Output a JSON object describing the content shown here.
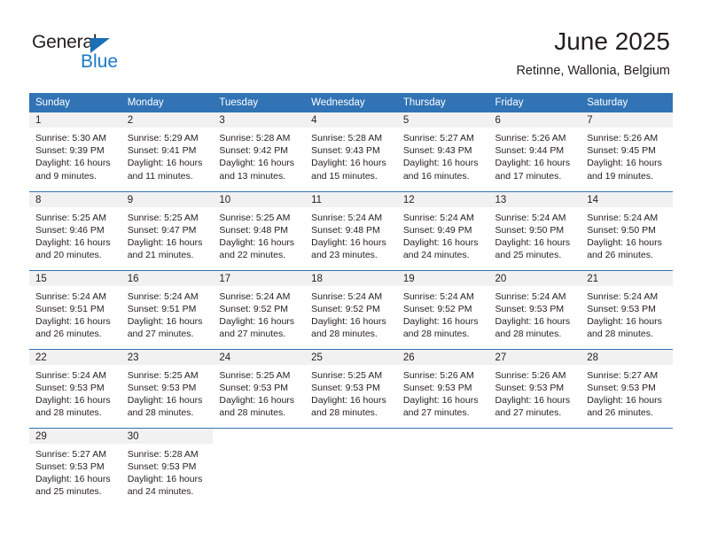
{
  "brand": {
    "word_one": "General",
    "word_two": "Blue",
    "flag_icon": "triangle-flag-icon",
    "accent_color": "#1a7ac4"
  },
  "header": {
    "title": "June 2025",
    "subtitle": "Retinne, Wallonia, Belgium"
  },
  "theme": {
    "header_blue": "#3173b5",
    "daynum_gray": "#f1f1f1",
    "text_color": "#231f20"
  },
  "weekday_headers": [
    "Sunday",
    "Monday",
    "Tuesday",
    "Wednesday",
    "Thursday",
    "Friday",
    "Saturday"
  ],
  "weeks": [
    [
      {
        "day": "1",
        "sunrise": "Sunrise: 5:30 AM",
        "sunset": "Sunset: 9:39 PM",
        "daylight": "Daylight: 16 hours and 9 minutes."
      },
      {
        "day": "2",
        "sunrise": "Sunrise: 5:29 AM",
        "sunset": "Sunset: 9:41 PM",
        "daylight": "Daylight: 16 hours and 11 minutes."
      },
      {
        "day": "3",
        "sunrise": "Sunrise: 5:28 AM",
        "sunset": "Sunset: 9:42 PM",
        "daylight": "Daylight: 16 hours and 13 minutes."
      },
      {
        "day": "4",
        "sunrise": "Sunrise: 5:28 AM",
        "sunset": "Sunset: 9:43 PM",
        "daylight": "Daylight: 16 hours and 15 minutes."
      },
      {
        "day": "5",
        "sunrise": "Sunrise: 5:27 AM",
        "sunset": "Sunset: 9:43 PM",
        "daylight": "Daylight: 16 hours and 16 minutes."
      },
      {
        "day": "6",
        "sunrise": "Sunrise: 5:26 AM",
        "sunset": "Sunset: 9:44 PM",
        "daylight": "Daylight: 16 hours and 17 minutes."
      },
      {
        "day": "7",
        "sunrise": "Sunrise: 5:26 AM",
        "sunset": "Sunset: 9:45 PM",
        "daylight": "Daylight: 16 hours and 19 minutes."
      }
    ],
    [
      {
        "day": "8",
        "sunrise": "Sunrise: 5:25 AM",
        "sunset": "Sunset: 9:46 PM",
        "daylight": "Daylight: 16 hours and 20 minutes."
      },
      {
        "day": "9",
        "sunrise": "Sunrise: 5:25 AM",
        "sunset": "Sunset: 9:47 PM",
        "daylight": "Daylight: 16 hours and 21 minutes."
      },
      {
        "day": "10",
        "sunrise": "Sunrise: 5:25 AM",
        "sunset": "Sunset: 9:48 PM",
        "daylight": "Daylight: 16 hours and 22 minutes."
      },
      {
        "day": "11",
        "sunrise": "Sunrise: 5:24 AM",
        "sunset": "Sunset: 9:48 PM",
        "daylight": "Daylight: 16 hours and 23 minutes."
      },
      {
        "day": "12",
        "sunrise": "Sunrise: 5:24 AM",
        "sunset": "Sunset: 9:49 PM",
        "daylight": "Daylight: 16 hours and 24 minutes."
      },
      {
        "day": "13",
        "sunrise": "Sunrise: 5:24 AM",
        "sunset": "Sunset: 9:50 PM",
        "daylight": "Daylight: 16 hours and 25 minutes."
      },
      {
        "day": "14",
        "sunrise": "Sunrise: 5:24 AM",
        "sunset": "Sunset: 9:50 PM",
        "daylight": "Daylight: 16 hours and 26 minutes."
      }
    ],
    [
      {
        "day": "15",
        "sunrise": "Sunrise: 5:24 AM",
        "sunset": "Sunset: 9:51 PM",
        "daylight": "Daylight: 16 hours and 26 minutes."
      },
      {
        "day": "16",
        "sunrise": "Sunrise: 5:24 AM",
        "sunset": "Sunset: 9:51 PM",
        "daylight": "Daylight: 16 hours and 27 minutes."
      },
      {
        "day": "17",
        "sunrise": "Sunrise: 5:24 AM",
        "sunset": "Sunset: 9:52 PM",
        "daylight": "Daylight: 16 hours and 27 minutes."
      },
      {
        "day": "18",
        "sunrise": "Sunrise: 5:24 AM",
        "sunset": "Sunset: 9:52 PM",
        "daylight": "Daylight: 16 hours and 28 minutes."
      },
      {
        "day": "19",
        "sunrise": "Sunrise: 5:24 AM",
        "sunset": "Sunset: 9:52 PM",
        "daylight": "Daylight: 16 hours and 28 minutes."
      },
      {
        "day": "20",
        "sunrise": "Sunrise: 5:24 AM",
        "sunset": "Sunset: 9:53 PM",
        "daylight": "Daylight: 16 hours and 28 minutes."
      },
      {
        "day": "21",
        "sunrise": "Sunrise: 5:24 AM",
        "sunset": "Sunset: 9:53 PM",
        "daylight": "Daylight: 16 hours and 28 minutes."
      }
    ],
    [
      {
        "day": "22",
        "sunrise": "Sunrise: 5:24 AM",
        "sunset": "Sunset: 9:53 PM",
        "daylight": "Daylight: 16 hours and 28 minutes."
      },
      {
        "day": "23",
        "sunrise": "Sunrise: 5:25 AM",
        "sunset": "Sunset: 9:53 PM",
        "daylight": "Daylight: 16 hours and 28 minutes."
      },
      {
        "day": "24",
        "sunrise": "Sunrise: 5:25 AM",
        "sunset": "Sunset: 9:53 PM",
        "daylight": "Daylight: 16 hours and 28 minutes."
      },
      {
        "day": "25",
        "sunrise": "Sunrise: 5:25 AM",
        "sunset": "Sunset: 9:53 PM",
        "daylight": "Daylight: 16 hours and 28 minutes."
      },
      {
        "day": "26",
        "sunrise": "Sunrise: 5:26 AM",
        "sunset": "Sunset: 9:53 PM",
        "daylight": "Daylight: 16 hours and 27 minutes."
      },
      {
        "day": "27",
        "sunrise": "Sunrise: 5:26 AM",
        "sunset": "Sunset: 9:53 PM",
        "daylight": "Daylight: 16 hours and 27 minutes."
      },
      {
        "day": "28",
        "sunrise": "Sunrise: 5:27 AM",
        "sunset": "Sunset: 9:53 PM",
        "daylight": "Daylight: 16 hours and 26 minutes."
      }
    ],
    [
      {
        "day": "29",
        "sunrise": "Sunrise: 5:27 AM",
        "sunset": "Sunset: 9:53 PM",
        "daylight": "Daylight: 16 hours and 25 minutes."
      },
      {
        "day": "30",
        "sunrise": "Sunrise: 5:28 AM",
        "sunset": "Sunset: 9:53 PM",
        "daylight": "Daylight: 16 hours and 24 minutes."
      },
      {
        "day": "",
        "sunrise": "",
        "sunset": "",
        "daylight": ""
      },
      {
        "day": "",
        "sunrise": "",
        "sunset": "",
        "daylight": ""
      },
      {
        "day": "",
        "sunrise": "",
        "sunset": "",
        "daylight": ""
      },
      {
        "day": "",
        "sunrise": "",
        "sunset": "",
        "daylight": ""
      },
      {
        "day": "",
        "sunrise": "",
        "sunset": "",
        "daylight": ""
      }
    ]
  ]
}
